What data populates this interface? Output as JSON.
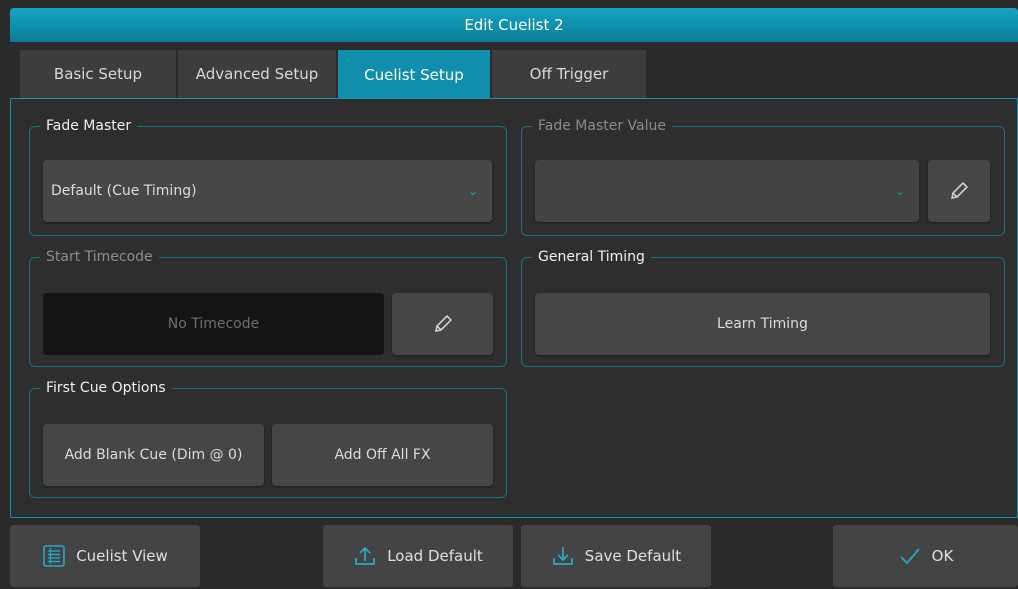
{
  "dialog": {
    "title": "Edit Cuelist 2"
  },
  "tabs": [
    {
      "label": "Basic Setup",
      "active": false
    },
    {
      "label": "Advanced Setup",
      "active": false
    },
    {
      "label": "Cuelist Setup",
      "active": true
    },
    {
      "label": "Off Trigger",
      "active": false
    }
  ],
  "fade_master": {
    "title": "Fade Master",
    "selected": "Default (Cue Timing)"
  },
  "fade_master_value": {
    "title": "Fade Master Value",
    "selected": ""
  },
  "start_timecode": {
    "title": "Start Timecode",
    "value": "No Timecode"
  },
  "general_timing": {
    "title": "General Timing",
    "learn_label": "Learn Timing"
  },
  "first_cue_options": {
    "title": "First Cue Options",
    "add_blank_label": "Add Blank Cue (Dim @ 0)",
    "add_off_fx_label": "Add Off All FX"
  },
  "footer": {
    "cuelist_view": "Cuelist View",
    "load_default": "Load Default",
    "save_default": "Save Default",
    "ok": "OK"
  },
  "colors": {
    "accent": "#0f8fad",
    "panel": "#2e2e2e",
    "button": "#464646"
  }
}
